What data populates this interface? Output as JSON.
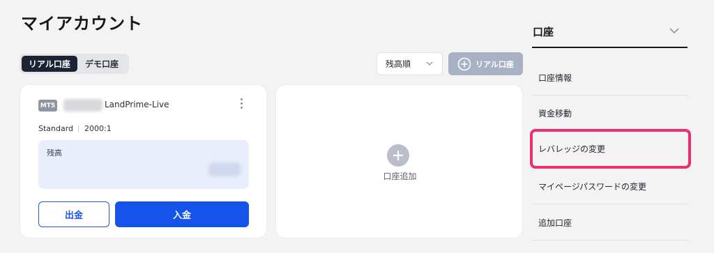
{
  "page": {
    "title": "マイアカウント"
  },
  "tabs": [
    {
      "label": "リアル口座",
      "active": true
    },
    {
      "label": "デモ口座",
      "active": false
    }
  ],
  "sort": {
    "selected": "残高順"
  },
  "add_real_button": {
    "label": "リアル口座",
    "icon": "plus-circle-icon"
  },
  "account_card": {
    "platform_badge": "MT5",
    "account_name": "LandPrime-Live",
    "account_type": "Standard",
    "leverage": "2000:1",
    "balance_label": "残高",
    "withdraw_label": "出金",
    "deposit_label": "入金"
  },
  "add_account_card": {
    "label": "口座追加",
    "icon": "plus-circle-icon"
  },
  "side_panel": {
    "title": "口座",
    "items": [
      {
        "label": "口座情報"
      },
      {
        "label": "資金移動"
      },
      {
        "label": "レバレッジの変更",
        "highlighted": true
      },
      {
        "label": "マイページパスワードの変更"
      },
      {
        "label": "追加口座"
      }
    ]
  },
  "colors": {
    "primary": "#1653ea",
    "tab_active": "#1e2235",
    "highlight": "#ee2e68",
    "disabled_button": "#a9b1c4"
  }
}
